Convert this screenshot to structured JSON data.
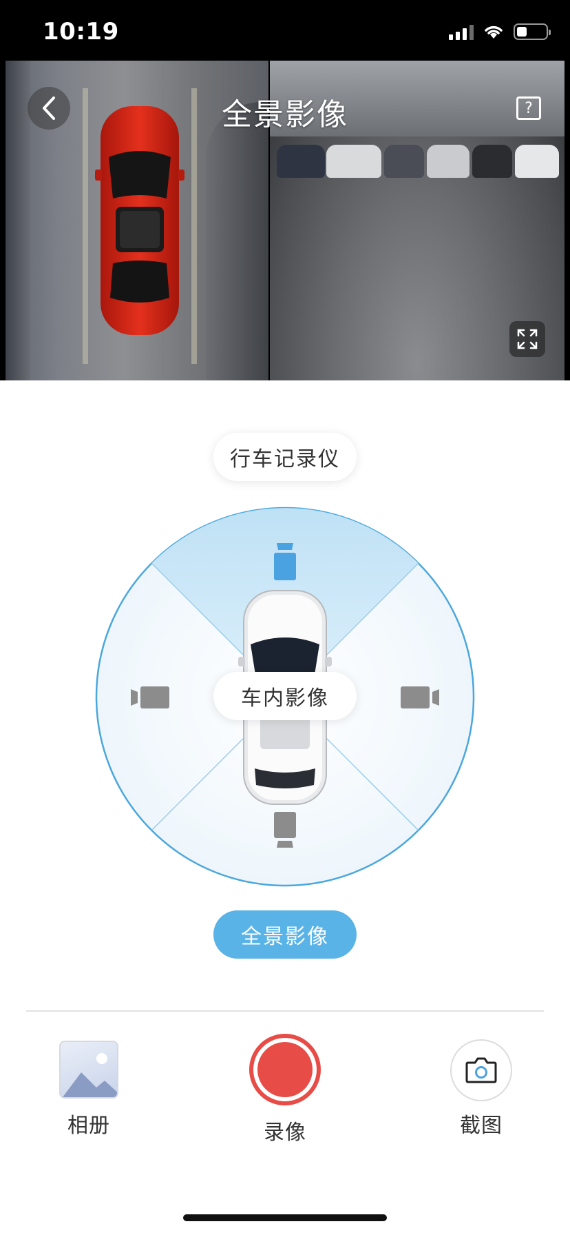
{
  "status_bar": {
    "time": "10:19"
  },
  "header": {
    "title": "全景影像"
  },
  "modes": {
    "dashcam": "行车记录仪",
    "interior": "车内影像",
    "panorama": "全景影像"
  },
  "toolbar": {
    "album": "相册",
    "record": "录像",
    "screenshot": "截图"
  },
  "colors": {
    "accent": "#5ab3e6",
    "record": "#e84c47",
    "radar_stroke": "#4aa7dd",
    "radar_active": "#bfe1f5",
    "camera_icon_active": "#4aa3e0",
    "camera_icon_inactive": "#8c8c8c"
  },
  "icons": {
    "back": "chevron-left-icon",
    "help": "question-icon",
    "expand": "expand-icon",
    "album": "image-icon",
    "screenshot": "camera-icon"
  },
  "radar": {
    "active_camera": "front"
  }
}
